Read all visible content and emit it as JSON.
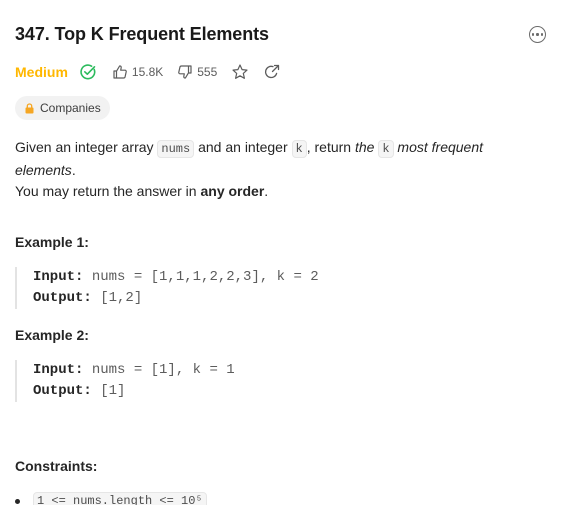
{
  "problem": {
    "title": "347. Top K Frequent Elements",
    "difficulty": "Medium",
    "likes": "15.8K",
    "dislikes": "555",
    "companies_label": "Companies"
  },
  "description": {
    "p1_a": "Given an integer array ",
    "p1_code1": "nums",
    "p1_b": " and an integer ",
    "p1_code2": "k",
    "p1_c": ", return ",
    "p1_em1": "the ",
    "p1_code3": "k",
    "p1_em2": " most frequent elements",
    "p1_d": ".",
    "p2_a": "You may return the answer in ",
    "p2_bold": "any order",
    "p2_b": "."
  },
  "examples": [
    {
      "title": "Example 1:",
      "input_label": "Input:",
      "input_value": " nums = [1,1,1,2,2,3], k = 2",
      "output_label": "Output:",
      "output_value": " [1,2]"
    },
    {
      "title": "Example 2:",
      "input_label": "Input:",
      "input_value": " nums = [1], k = 1",
      "output_label": "Output:",
      "output_value": " [1]"
    }
  ],
  "constraints": {
    "title": "Constraints:",
    "items": [
      "1 <= nums.length <= 10⁵"
    ]
  },
  "colors": {
    "difficulty": "#ffb700",
    "solved": "#2cbb5d"
  },
  "icons": [
    "more-icon",
    "solved-check-icon",
    "thumbs-up-icon",
    "thumbs-down-icon",
    "star-icon",
    "share-icon",
    "lock-icon"
  ]
}
